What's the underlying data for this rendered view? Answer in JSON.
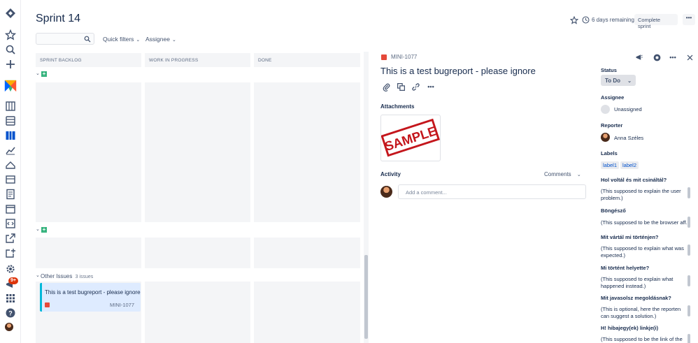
{
  "board": {
    "title": "Sprint 14",
    "quick_filters_label": "Quick filters",
    "assignee_label": "Assignee",
    "columns": [
      "SPRINT BACKLOG",
      "WORK IN PROGRESS",
      "DONE"
    ],
    "other_issues_label": "Other Issues",
    "other_issues_count": "3 issues"
  },
  "top": {
    "remaining": "6 days remaining",
    "complete_label": "Complete sprint",
    "more_label": "•••"
  },
  "card": {
    "summary": "This is a test bugreport - please ignore",
    "key": "MINI-1077"
  },
  "issue": {
    "key": "MINI-1077",
    "title": "This is a test bugreport - please ignore",
    "attachments_label": "Attachments",
    "attachment_stamp": "SAMPLE",
    "activity_label": "Activity",
    "comments_label": "Comments",
    "comment_placeholder": "Add a comment..."
  },
  "side": {
    "status_label": "Status",
    "status_value": "To Do",
    "assignee_label": "Assignee",
    "assignee_value": "Unassigned",
    "reporter_label": "Reporter",
    "reporter_value": "Anna Széles",
    "labels_label": "Labels",
    "labels": [
      "label1",
      "label2"
    ],
    "fields": [
      {
        "label": "Hol voltál és mit csináltál?",
        "help": "(This supposed to explain the user problem.)"
      },
      {
        "label": "Böngésző",
        "help": "(This supposed to be the browser aff..."
      },
      {
        "label": "Mit vártál mi történjen?",
        "help": "(This supposed to explain what was expected.)"
      },
      {
        "label": "Mi történt helyette?",
        "help": "(This supposed to explain what happened instead.)"
      },
      {
        "label": "Mit javasolsz megoldásnak?",
        "help": "(This is optional, here the reporten can suggest a solution.)"
      },
      {
        "label": "H! hibajegy(ek) linkje(i)",
        "help": "(This supposed to be the link of the"
      }
    ]
  },
  "nav": {
    "notification_count": "9+"
  },
  "colors": {
    "accent": "#0052CC",
    "card_bg": "#DEEBFF",
    "card_border": "#00B8D9",
    "add_green": "#36B37E",
    "bug_red": "#E5493A"
  },
  "icons": [
    "jira-logo-icon",
    "star-icon",
    "search-icon",
    "create-icon",
    "project-icon",
    "backlog-icon",
    "board-icon",
    "reports-icon",
    "releases-icon",
    "components-icon",
    "pages-icon",
    "calendar-icon",
    "code-icon",
    "shortcut-icon",
    "add-shortcut-icon",
    "settings-icon",
    "notifications-icon",
    "apps-icon",
    "help-icon",
    "profile-avatar"
  ]
}
